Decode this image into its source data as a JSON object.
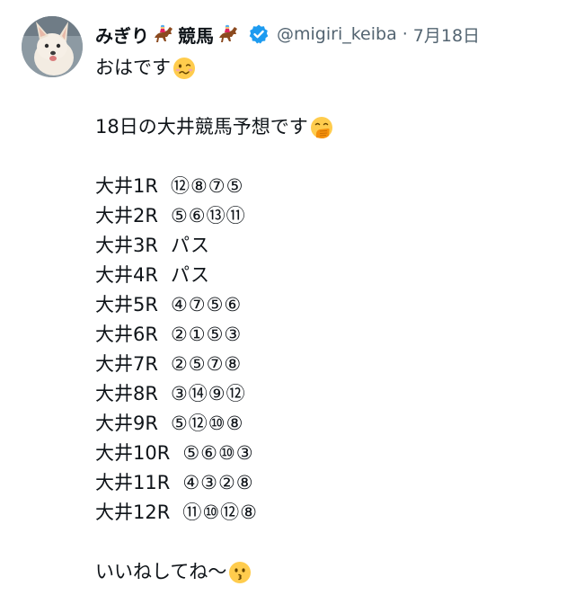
{
  "user": {
    "display_name": "みぎり",
    "display_name_suffix": "競馬",
    "name_emoji": "horse-racing-icon",
    "verified": true,
    "handle": "@migiri_keiba",
    "separator": "·",
    "date": "7月18日"
  },
  "tweet": {
    "greeting": "おはです",
    "greeting_emoji": "woozy-face-icon",
    "intro": "18日の大井競馬予想です",
    "intro_emoji": "face-with-hand-over-mouth-icon",
    "races": [
      {
        "race": "大井1R",
        "picks": "⑫⑧⑦⑤"
      },
      {
        "race": "大井2R",
        "picks": "⑤⑥⑬⑪"
      },
      {
        "race": "大井3R",
        "picks": "パス"
      },
      {
        "race": "大井4R",
        "picks": "パス"
      },
      {
        "race": "大井5R",
        "picks": "④⑦⑤⑥"
      },
      {
        "race": "大井6R",
        "picks": "②①⑤③"
      },
      {
        "race": "大井7R",
        "picks": "②⑤⑦⑧"
      },
      {
        "race": "大井8R",
        "picks": "③⑭⑨⑫"
      },
      {
        "race": "大井9R",
        "picks": "⑤⑫⑩⑧"
      },
      {
        "race": "大井10R",
        "picks": "⑤⑥⑩③"
      },
      {
        "race": "大井11R",
        "picks": "④③②⑧"
      },
      {
        "race": "大井12R",
        "picks": "⑪⑩⑫⑧"
      }
    ],
    "outro": "いいねしてね〜",
    "outro_emoji": "kissing-face-icon"
  },
  "colors": {
    "text": "#0f1419",
    "secondary": "#536471",
    "verified": "#1d9bf0",
    "emoji_yellow": "#ffcc4d"
  }
}
